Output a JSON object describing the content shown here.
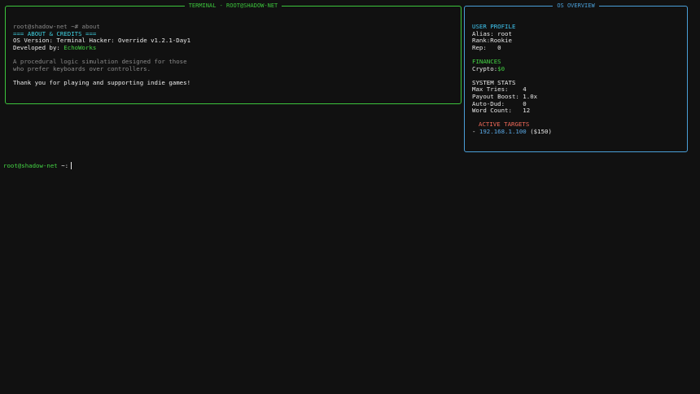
{
  "terminal": {
    "title": "TERMINAL - ROOT@SHADOW-NET",
    "echo_command": "root@shadow-net ~# about",
    "about_header": "=== ABOUT & CREDITS ===",
    "os_version_label": "OS Version: ",
    "os_version_value": "Terminal Hacker: Override v1.2.1-Day1",
    "developed_by_label": "Developed by: ",
    "developed_by_value": "EchoWorks",
    "description_line1": "A procedural logic simulation designed for those",
    "description_line2": "who prefer keyboards over controllers.",
    "thanks": "Thank you for playing and supporting indie games!"
  },
  "overview": {
    "title": "OS OVERVIEW",
    "user_profile": {
      "heading": "USER PROFILE",
      "alias_label": "Alias: ",
      "alias_value": "root",
      "rank_label": "Rank:",
      "rank_value": "Rookie",
      "rep_label": "Rep:   ",
      "rep_value": "0"
    },
    "finances": {
      "heading": "FINANCES",
      "crypto_label": "Crypto:",
      "crypto_value": "$0"
    },
    "system_stats": {
      "heading": "SYSTEM STATS",
      "max_tries_label": "Max Tries:    ",
      "max_tries_value": "4",
      "payout_label": "Payout Boost: ",
      "payout_value": "1.0x",
      "auto_dud_label": "Auto-Dud:     ",
      "auto_dud_value": "0",
      "word_count_label": "Word Count:   ",
      "word_count_value": "12"
    },
    "active_targets": {
      "heading": "ACTIVE TARGETS",
      "items": [
        {
          "bullet": "- ",
          "ip": "192.168.1.100",
          "reward": " ($150)"
        }
      ]
    }
  },
  "prompt": {
    "host": "root@shadow-net",
    "symbol": " ~:"
  },
  "colors": {
    "terminal_border": "#3cc43c",
    "overview_border": "#4a9fd8",
    "background": "#111111"
  }
}
